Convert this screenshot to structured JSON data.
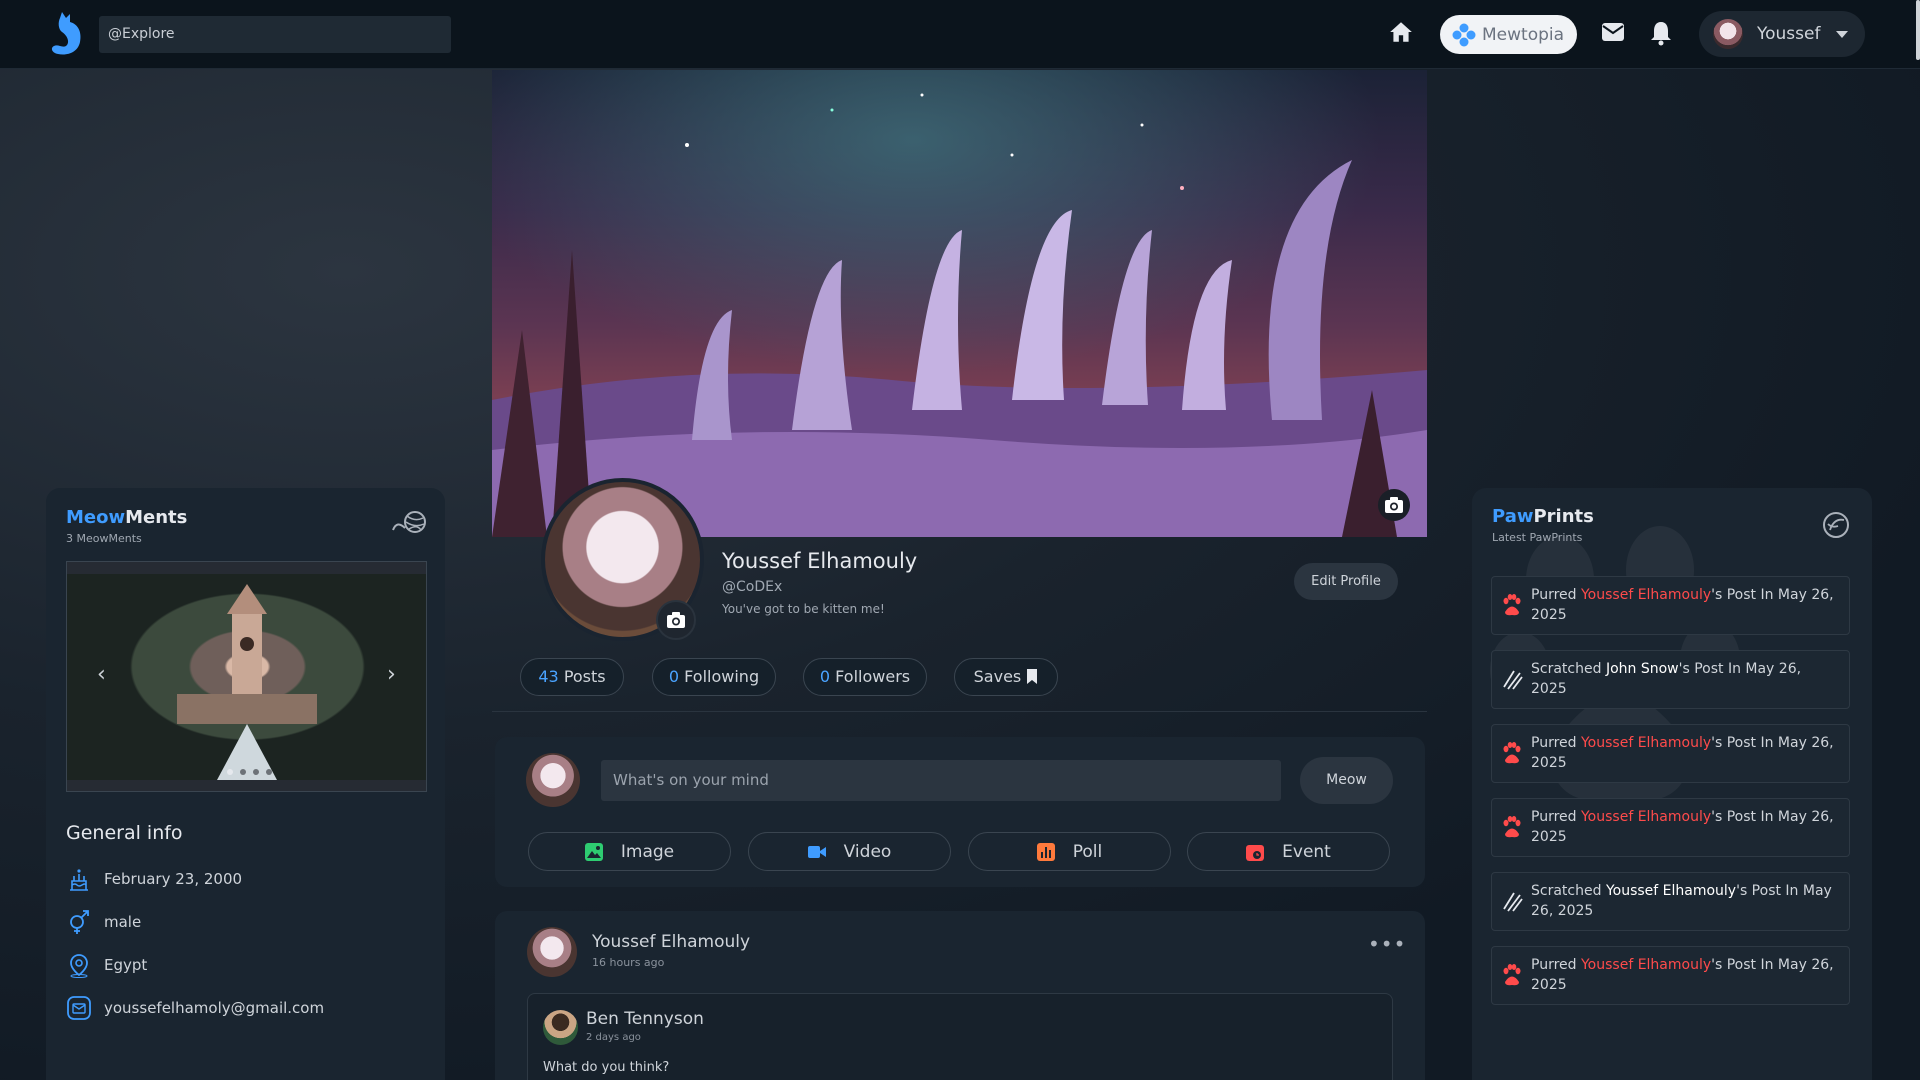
{
  "header": {
    "search_value": "@Explore",
    "brand_label": "Mewtopia",
    "user_name": "Youssef"
  },
  "profile": {
    "name": "Youssef Elhamouly",
    "handle": "@CoDEx",
    "bio": "You've got to be kitten me!",
    "edit_label": "Edit Profile",
    "stats": [
      {
        "num": "43",
        "label": "Posts"
      },
      {
        "num": "0",
        "label": "Following"
      },
      {
        "num": "0",
        "label": "Followers"
      },
      {
        "num": "",
        "label": "Saves"
      }
    ]
  },
  "composer": {
    "placeholder": "What's on your mind",
    "submit_label": "Meow",
    "attachments": [
      {
        "label": "Image",
        "icon": "image-icon",
        "color": "#2ecc71"
      },
      {
        "label": "Video",
        "icon": "video-icon",
        "color": "#3f9cff"
      },
      {
        "label": "Poll",
        "icon": "poll-icon",
        "color": "#ff7a3c"
      },
      {
        "label": "Event",
        "icon": "event-icon",
        "color": "#ff4b4b"
      }
    ]
  },
  "post": {
    "author": "Youssef Elhamouly",
    "time": "16 hours ago",
    "shared": {
      "author": "Ben Tennyson",
      "time": "2 days ago",
      "text": "What do you think?"
    }
  },
  "meowments": {
    "title_accent": "Meow",
    "title_rest": "Ments",
    "subtitle": "3 MeowMents",
    "slides": 4,
    "active_slide": 1
  },
  "general_info": {
    "title": "General info",
    "birthday": "February 23, 2000",
    "gender": "male",
    "country": "Egypt",
    "email": "youssefelhamoly@gmail.com"
  },
  "pawprints": {
    "title_accent": "Paw",
    "title_rest": "Prints",
    "subtitle": "Latest PawPrints",
    "items": [
      {
        "type": "purr",
        "verb": "Purred",
        "who": "Youssef Elhamouly",
        "rest": "'s Post In May 26, 2025"
      },
      {
        "type": "scratch",
        "verb": "Scratched",
        "who": "John Snow",
        "rest": "'s Post In May 26, 2025"
      },
      {
        "type": "purr",
        "verb": "Purred",
        "who": "Youssef Elhamouly",
        "rest": "'s Post In May 26, 2025"
      },
      {
        "type": "purr",
        "verb": "Purred",
        "who": "Youssef Elhamouly",
        "rest": "'s Post In May 26, 2025"
      },
      {
        "type": "scratch",
        "verb": "Scratched",
        "who": "Youssef Elhamouly",
        "rest": "'s Post In May 26, 2025"
      },
      {
        "type": "purr",
        "verb": "Purred",
        "who": "Youssef Elhamouly",
        "rest": "'s Post In May 26, 2025"
      }
    ]
  },
  "colors": {
    "accent_blue": "#3f9cff",
    "accent_red": "#ff4b4b",
    "panel": "#1a2530",
    "page_bg": "#111a24"
  }
}
